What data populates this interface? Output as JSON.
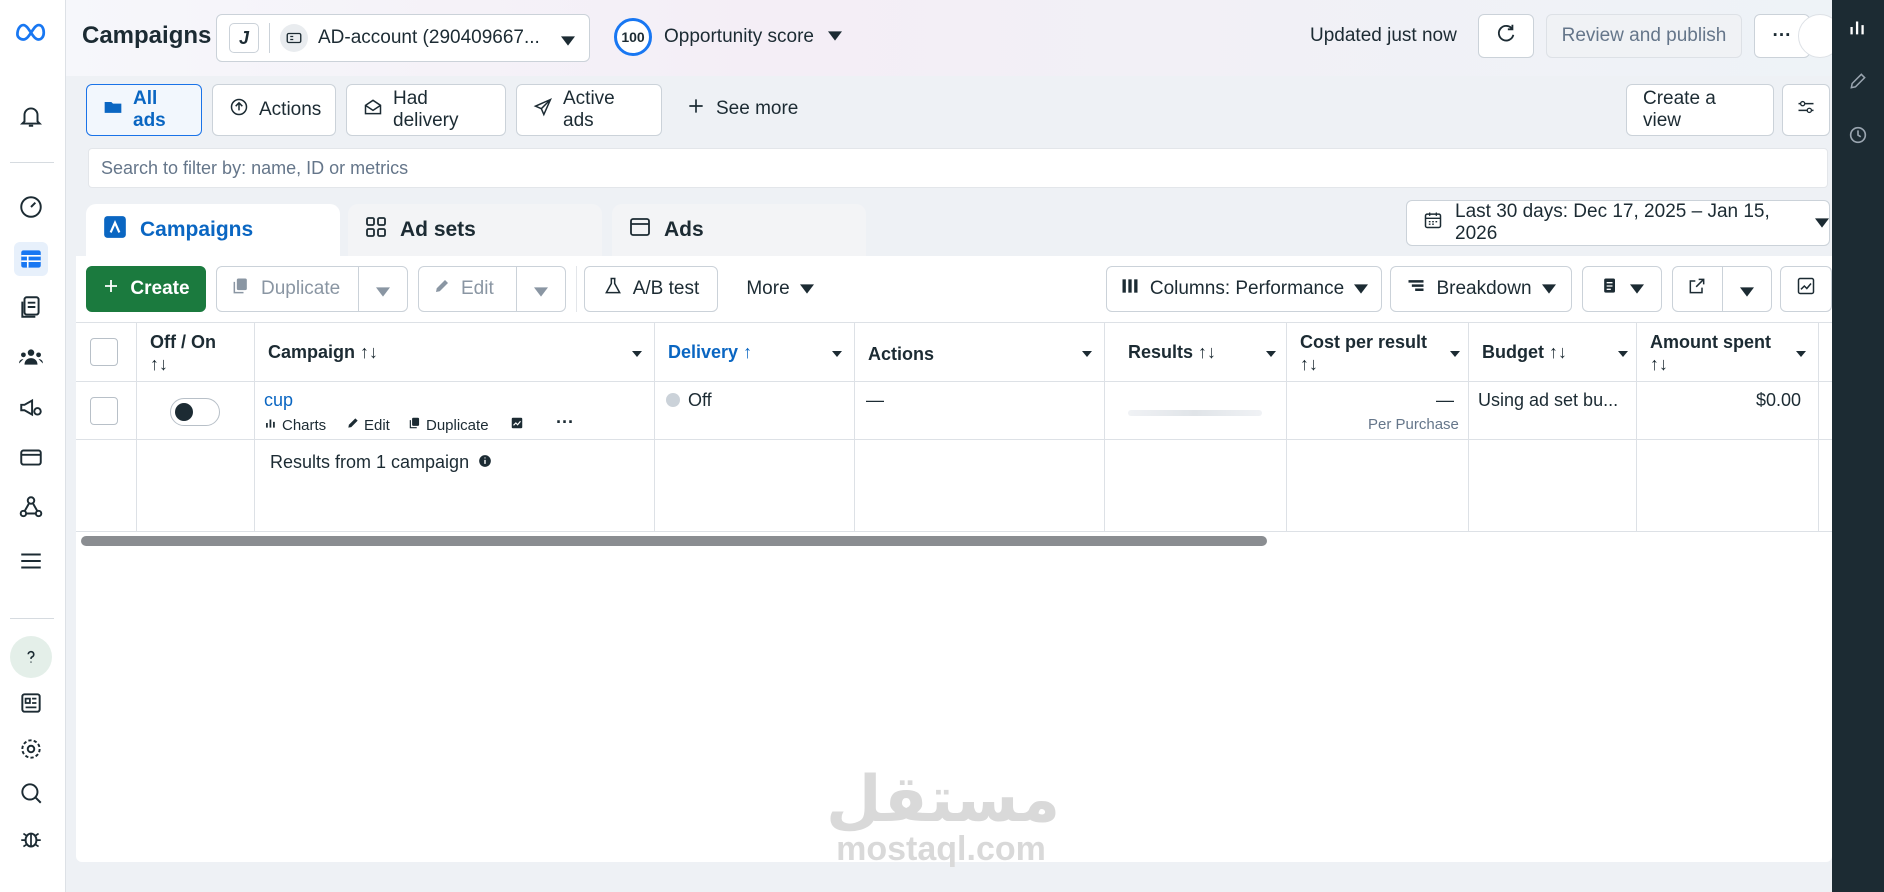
{
  "colors": {
    "brand": "#1877f2",
    "create": "#1b7a3e",
    "link": "#0a66c2",
    "rail": "#1c2b33"
  },
  "header": {
    "title": "Campaigns",
    "account_initial": "J",
    "account_name": "AD-account (290409667...",
    "opportunity_score": "100",
    "opportunity_label": "Opportunity score",
    "updated": "Updated just now",
    "review_publish": "Review and publish",
    "more": "···"
  },
  "filters": {
    "all_ads": "All ads",
    "actions": "Actions",
    "had_delivery": "Had delivery",
    "active_ads": "Active ads",
    "see_more": "See more",
    "create_view": "Create a view"
  },
  "search": {
    "placeholder": "Search to filter by: name, ID or metrics"
  },
  "tabs": {
    "campaigns": "Campaigns",
    "ad_sets": "Ad sets",
    "ads": "Ads"
  },
  "date_range": "Last 30 days: Dec 17, 2025 – Jan 15, 2026",
  "toolbar": {
    "create": "Create",
    "duplicate": "Duplicate",
    "edit": "Edit",
    "ab_test": "A/B test",
    "more": "More",
    "columns": "Columns: Performance",
    "breakdown": "Breakdown"
  },
  "table": {
    "headers": {
      "off_on": "Off / On",
      "campaign": "Campaign",
      "delivery": "Delivery",
      "actions": "Actions",
      "results": "Results",
      "cost_per_result": "Cost per result",
      "budget": "Budget",
      "amount_spent": "Amount spent"
    },
    "row": {
      "campaign": "cup",
      "charts": "Charts",
      "edit": "Edit",
      "duplicate": "Duplicate",
      "delivery": "Off",
      "actions": "—",
      "cost": "—",
      "cost_sub": "Per Purchase",
      "budget": "Using ad set bu...",
      "amount_spent": "$0.00"
    },
    "summary": "Results from 1 campaign"
  },
  "watermark": {
    "arabic": "مستقل",
    "latin": "mostaql.com"
  }
}
